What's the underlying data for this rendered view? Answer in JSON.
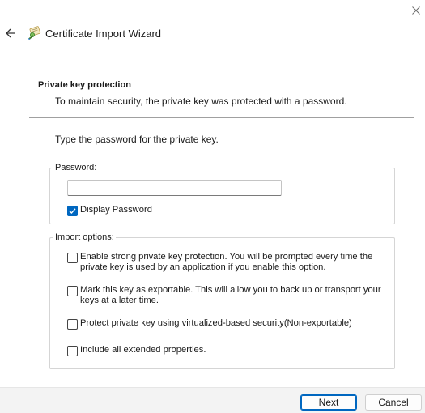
{
  "window": {
    "title": "Certificate Import Wizard"
  },
  "page": {
    "heading": "Private key protection",
    "subheading": "To maintain security, the private key was protected with a password.",
    "instruction": "Type the password for the private key."
  },
  "password": {
    "group_label": "Password:",
    "value": "",
    "display_password_label": "Display Password",
    "display_password_checked": true
  },
  "import_options": {
    "group_label": "Import options:",
    "options": [
      {
        "label": "Enable strong private key protection. You will be prompted every time the private key is used by an application if you enable this option.",
        "checked": false
      },
      {
        "label": "Mark this key as exportable. This will allow you to back up or transport your keys at a later time.",
        "checked": false
      },
      {
        "label": "Protect private key using virtualized-based security(Non-exportable)",
        "checked": false
      },
      {
        "label": "Include all extended properties.",
        "checked": false
      }
    ]
  },
  "footer": {
    "next_label": "Next",
    "cancel_label": "Cancel"
  },
  "colors": {
    "accent": "#0067c0"
  },
  "icons": {
    "close": "close-icon",
    "back": "back-arrow-icon",
    "wizard": "certificate-icon",
    "check": "checkmark-icon"
  }
}
